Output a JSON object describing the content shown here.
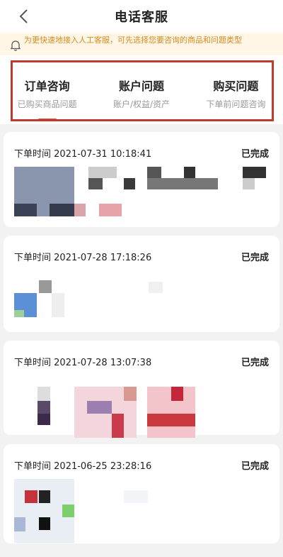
{
  "header": {
    "title": "电话客服"
  },
  "notice": {
    "text": "为更快速地接入人工客服，可先选择您要咨询的商品和问题类型"
  },
  "tabs": [
    {
      "label": "订单咨询",
      "sub": "已购买商品问题",
      "active": true
    },
    {
      "label": "账户问题",
      "sub": "账户/权益/资产"
    },
    {
      "label": "购买问题",
      "sub": "下单前问题咨询"
    }
  ],
  "orders": [
    {
      "time_label": "下单时间",
      "time": "2021-07-31 10:18:41",
      "status": "已完成"
    },
    {
      "time_label": "下单时间",
      "time": "2021-07-28 17:18:26",
      "status": "已完成"
    },
    {
      "time_label": "下单时间",
      "time": "2021-07-28 13:07:38",
      "status": "已完成"
    },
    {
      "time_label": "下单时间",
      "time": "2021-06-25 23:28:16",
      "status": "已完成"
    }
  ]
}
